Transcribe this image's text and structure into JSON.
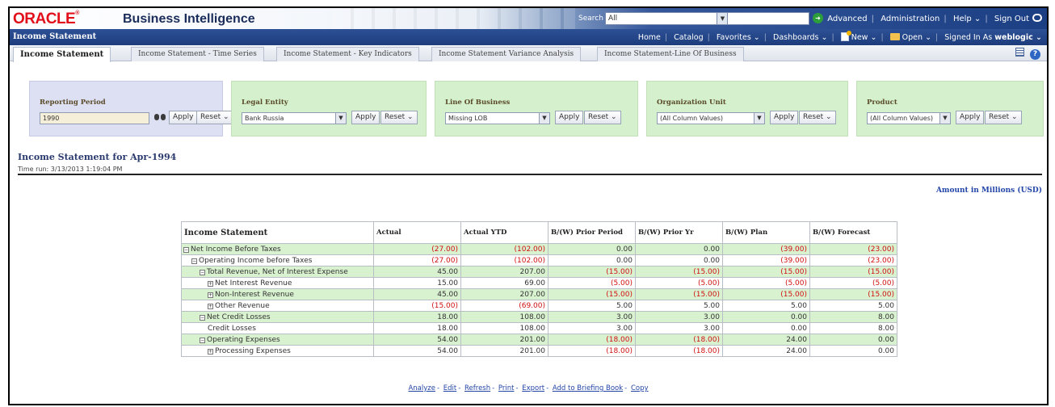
{
  "header": {
    "logo": "ORACLE",
    "app_title": "Business Intelligence",
    "search_label": "Search",
    "search_scope": "All",
    "search_placeholder": "",
    "links": [
      "Advanced",
      "Administration",
      "Help",
      "Sign Out"
    ]
  },
  "navbar": {
    "page_label": "Income Statement",
    "links": [
      "Home",
      "Catalog",
      "Favorites",
      "Dashboards",
      "New",
      "Open"
    ],
    "signed_in_label": "Signed In As",
    "user": "weblogic"
  },
  "tabs": [
    "Income Statement",
    "Income Statement - Time Series",
    "Income Statement - Key Indicators",
    "Income Statement Variance Analysis",
    "Income Statement-Line Of Business"
  ],
  "prompts": [
    {
      "label": "Reporting Period",
      "value": "1990",
      "apply": "Apply",
      "reset": "Reset"
    },
    {
      "label": "Legal Entity",
      "value": "Bank Russia",
      "apply": "Apply",
      "reset": "Reset"
    },
    {
      "label": "Line Of Business",
      "value": "Missing LOB",
      "apply": "Apply",
      "reset": "Reset"
    },
    {
      "label": "Organization Unit",
      "value": "(All Column Values)",
      "apply": "Apply",
      "reset": "Reset"
    },
    {
      "label": "Product",
      "value": "(All Column Values)",
      "apply": "Apply",
      "reset": "Reset"
    }
  ],
  "report": {
    "title": "Income Statement for Apr-1994",
    "time_run": "Time run: 3/13/2013 1:19:04 PM",
    "amount_note": "Amount in Millions (USD)"
  },
  "table": {
    "columns": [
      "Income Statement",
      "Actual",
      "Actual YTD",
      "B/(W) Prior Period",
      "B/(W) Prior Yr",
      "B/(W) Plan",
      "B/(W) Forecast"
    ],
    "rows": [
      {
        "label": "Net Income Before Taxes",
        "toggle": "minus",
        "level": 0,
        "green": true,
        "cells": [
          "(27.00)",
          "(102.00)",
          "0.00",
          "0.00",
          "(39.00)",
          "(23.00)"
        ]
      },
      {
        "label": "Operating Income before Taxes",
        "toggle": "minus",
        "level": 1,
        "green": false,
        "cells": [
          "(27.00)",
          "(102.00)",
          "0.00",
          "0.00",
          "(39.00)",
          "(23.00)"
        ]
      },
      {
        "label": "Total Revenue, Net of Interest Expense",
        "toggle": "minus",
        "level": 2,
        "green": true,
        "cells": [
          "45.00",
          "207.00",
          "(15.00)",
          "(15.00)",
          "(15.00)",
          "(15.00)"
        ]
      },
      {
        "label": "Net Interest Revenue",
        "toggle": "plus",
        "level": 3,
        "green": false,
        "cells": [
          "15.00",
          "69.00",
          "(5.00)",
          "(5.00)",
          "(5.00)",
          "(5.00)"
        ]
      },
      {
        "label": "Non-Interest Revenue",
        "toggle": "plus",
        "level": 3,
        "green": true,
        "cells": [
          "45.00",
          "207.00",
          "(15.00)",
          "(15.00)",
          "(15.00)",
          "(15.00)"
        ]
      },
      {
        "label": "Other Revenue",
        "toggle": "plus",
        "level": 3,
        "green": false,
        "cells": [
          "(15.00)",
          "(69.00)",
          "5.00",
          "5.00",
          "5.00",
          "5.00"
        ]
      },
      {
        "label": "Net Credit Losses",
        "toggle": "minus",
        "level": 2,
        "green": true,
        "cells": [
          "18.00",
          "108.00",
          "3.00",
          "3.00",
          "0.00",
          "8.00"
        ]
      },
      {
        "label": "Credit Losses",
        "toggle": "",
        "level": 3,
        "green": false,
        "cells": [
          "18.00",
          "108.00",
          "3.00",
          "3.00",
          "0.00",
          "8.00"
        ]
      },
      {
        "label": "Operating Expenses",
        "toggle": "minus",
        "level": 2,
        "green": true,
        "cells": [
          "54.00",
          "201.00",
          "(18.00)",
          "(18.00)",
          "24.00",
          "0.00"
        ]
      },
      {
        "label": "Processing Expenses",
        "toggle": "plus",
        "level": 3,
        "green": false,
        "cells": [
          "54.00",
          "201.00",
          "(18.00)",
          "(18.00)",
          "24.00",
          "0.00"
        ]
      }
    ]
  },
  "footer_links": [
    "Analyze",
    "Edit",
    "Refresh",
    "Print",
    "Export",
    "Add to Briefing Book",
    "Copy"
  ],
  "colors": {
    "oracle_red": "#e2101a",
    "navy": "#1d3c7c",
    "prompt_green": "#d4f0cc",
    "row_green": "#d8f1cf",
    "negative": "#d21010",
    "link": "#2346a8"
  }
}
